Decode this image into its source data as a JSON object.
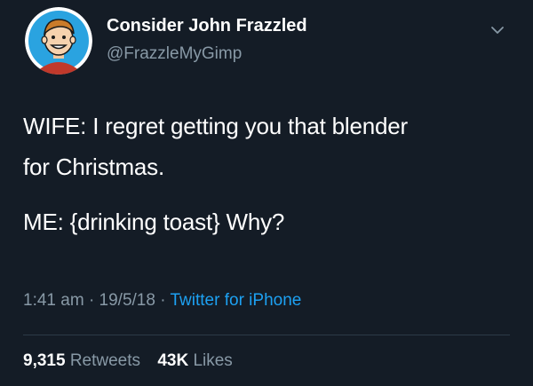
{
  "author": {
    "display_name": "Consider John Frazzled",
    "handle": "@FrazzleMyGimp",
    "avatar_icon": "cartoon-face-avatar"
  },
  "tweet": {
    "line1": "WIFE: I regret getting you that blender",
    "line2": "for Christmas.",
    "line3": "ME: {drinking toast} Why?"
  },
  "meta": {
    "time": "1:41 am",
    "separator1": "·",
    "date": "19/5/18",
    "separator2": "·",
    "source": "Twitter for iPhone"
  },
  "stats": {
    "retweets_count": "9,315",
    "retweets_label": "Retweets",
    "likes_count": "43K",
    "likes_label": "Likes"
  },
  "colors": {
    "background": "#141c26",
    "secondary_text": "#8899a6",
    "link": "#1da1f2",
    "avatar_bg": "#2aa3e0"
  }
}
